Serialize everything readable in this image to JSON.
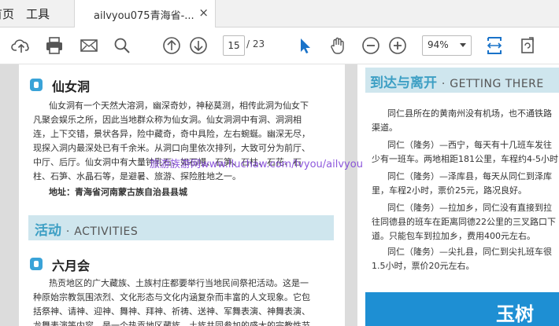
{
  "menu": {
    "home": "首页",
    "tools": "工具"
  },
  "tab": {
    "title": "ailvyou075青海省-...",
    "close": "×"
  },
  "toolbar": {
    "icons": [
      "upload-icon",
      "print-icon",
      "mail-icon",
      "search-icon",
      "page-up-icon",
      "page-down-icon",
      "pointer-icon",
      "hand-icon",
      "zoom-out-icon",
      "zoom-in-icon",
      "fit-page-icon",
      "rotate-icon"
    ],
    "page_current": "15",
    "page_total": "/ 23",
    "zoom": "94%"
  },
  "left_page": {
    "section1_title": "仙女洞",
    "section1_lines": [
      "仙女洞有一个天然大溶洞，幽深奇妙，神秘莫测，相传此洞为仙女下",
      "凡聚会娱乐之所，因此当地群众称为仙女洞。仙女洞洞中有洞、洞洞相",
      "连，上下交错，景状各异，险中藏奇，奇中具险，左右蜿蜒。幽深无尽，",
      "现探入洞内最深处已有千余米。从洞口向里依次排列，大致可分为前厅、",
      "中厅、后厅。仙女洞中有大量钟乳石，如石幔、石笋、石柱、石花、石",
      "柱、石笋、水晶石等，是避暑、旅游、探险胜地之一。"
    ],
    "address_label": "地址：青海省河南蒙古族自治县县城",
    "band_cn": "活动",
    "band_dot": "·",
    "band_en": "ACTIVITIES",
    "section2_title": "六月会",
    "section2_lines": [
      "热贡地区的广大藏族、土族村庄都要举行当地民间祭祀活动。这是一",
      "种原始宗教氛围浓烈、文化形态与文化内涵复杂而丰富的人文现象。它包",
      "括祭神、请神、迎神、舞神、拜神、祈祷、送神、军舞表演、神舞表演、",
      "龙舞表演等内容，是一个热贡地区藏族、土族共同参加的盛大的宗教性节"
    ]
  },
  "watermark": "旅游族游网www.lIuchaw.com/lvyou/ailvyou",
  "right_page": {
    "band_cn": "到达与离开",
    "band_dot": "·",
    "band_en": "GETTING THERE",
    "lines": [
      "同仁县所在的黄南州没有机场，也不通铁路",
      "渠道。",
      "同仁（隆务）—西宁，每天有十几班车发往",
      "少有一班车。两地相距181公里，车程约4-5小时",
      "同仁（隆务）—泽库县，每天从同仁到泽库",
      "里，车程2小时，票价25元，路况良好。",
      "同仁（隆务）—拉加乡，同仁没有直接到拉",
      "往同德县的班车在距离同德22公里的三叉路口下",
      "道。只能包车到拉加乡，费用400元左右。",
      "同仁（隆务）—尖扎县，同仁到尖扎班车很",
      "1.5小时，票价20元左右。"
    ],
    "footer_band": "玉树"
  }
}
